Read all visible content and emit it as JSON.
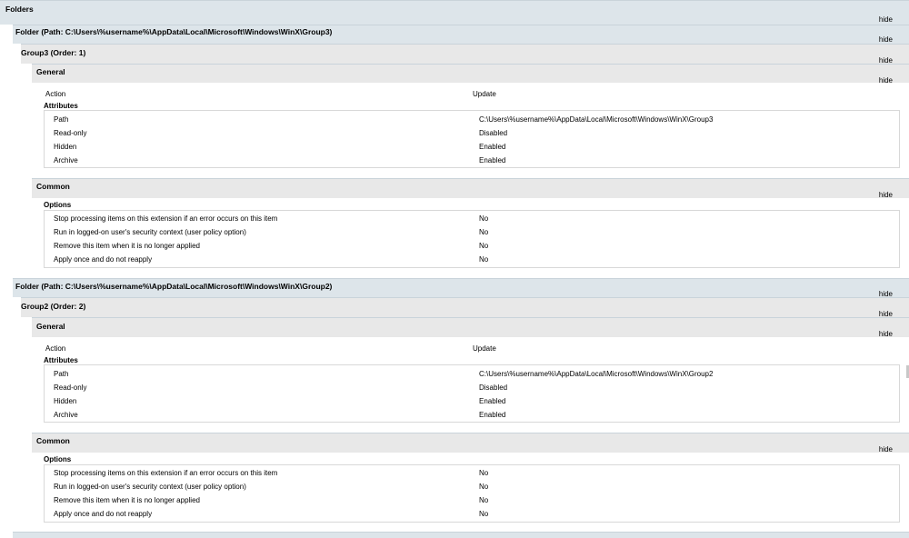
{
  "hide_label": "hide",
  "folders_title": "Folders",
  "folder3": {
    "title": "Folder (Path: C:\\Users\\%username%\\AppData\\Local\\Microsoft\\Windows\\WinX\\Group3)",
    "group": "Group3 (Order: 1)",
    "general": "General",
    "action_label": "Action",
    "action_value": "Update",
    "attributes": "Attributes",
    "attrs": [
      {
        "name": "Path",
        "value": "C:\\Users\\%username%\\AppData\\Local\\Microsoft\\Windows\\WinX\\Group3"
      },
      {
        "name": "Read-only",
        "value": "Disabled"
      },
      {
        "name": "Hidden",
        "value": "Enabled"
      },
      {
        "name": "Archive",
        "value": "Enabled"
      }
    ],
    "common": "Common",
    "options": "Options",
    "opts": [
      {
        "name": "Stop processing items on this extension if an error occurs on this item",
        "value": "No"
      },
      {
        "name": "Run in logged-on user's security context (user policy option)",
        "value": "No"
      },
      {
        "name": "Remove this item when it is no longer applied",
        "value": "No"
      },
      {
        "name": "Apply once and do not reapply",
        "value": "No"
      }
    ]
  },
  "folder2": {
    "title": "Folder (Path: C:\\Users\\%username%\\AppData\\Local\\Microsoft\\Windows\\WinX\\Group2)",
    "group": "Group2 (Order: 2)",
    "general": "General",
    "action_label": "Action",
    "action_value": "Update",
    "attributes": "Attributes",
    "attrs": [
      {
        "name": "Path",
        "value": "C:\\Users\\%username%\\AppData\\Local\\Microsoft\\Windows\\WinX\\Group2"
      },
      {
        "name": "Read-only",
        "value": "Disabled"
      },
      {
        "name": "Hidden",
        "value": "Enabled"
      },
      {
        "name": "Archive",
        "value": "Enabled"
      }
    ],
    "common": "Common",
    "options": "Options",
    "opts": [
      {
        "name": "Stop processing items on this extension if an error occurs on this item",
        "value": "No"
      },
      {
        "name": "Run in logged-on user's security context (user policy option)",
        "value": "No"
      },
      {
        "name": "Remove this item when it is no longer applied",
        "value": "No"
      },
      {
        "name": "Apply once and do not reapply",
        "value": "No"
      }
    ]
  }
}
